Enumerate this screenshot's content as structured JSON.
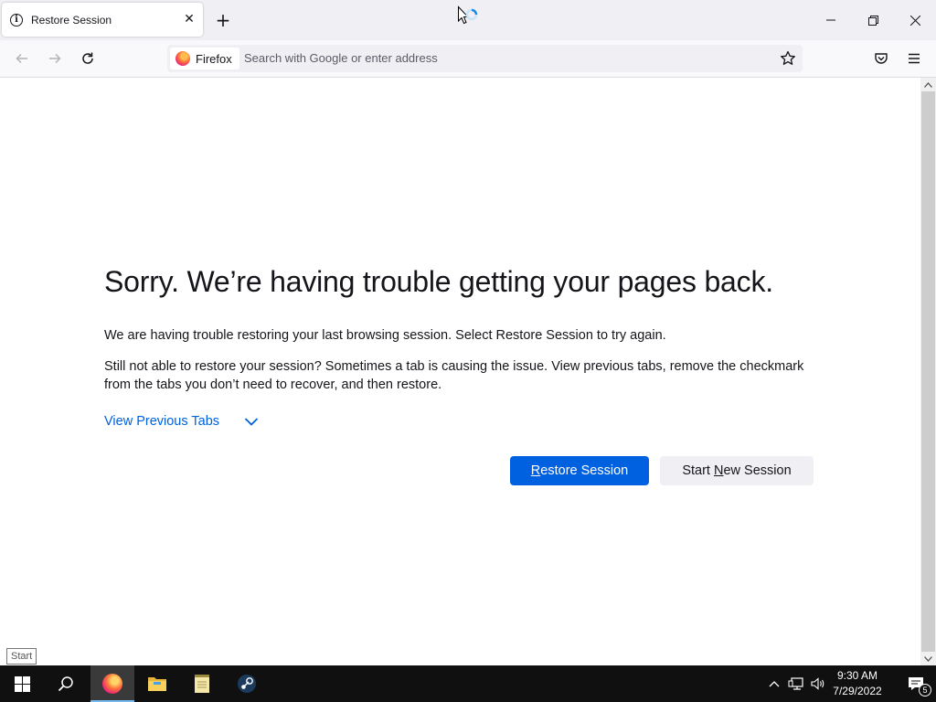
{
  "tab": {
    "title": "Restore Session"
  },
  "navbar": {
    "identity_label": "Firefox",
    "search_placeholder": "Search with Google or enter address"
  },
  "page": {
    "heading": "Sorry. We’re having trouble getting your pages back.",
    "paragraph1": "We are having trouble restoring your last browsing session. Select Restore Session to try again.",
    "paragraph2": "Still not able to restore your session? Sometimes a tab is causing the issue. View previous tabs, remove the checkmark from the tabs you don’t need to recover, and then restore.",
    "view_previous_tabs": "View Previous Tabs",
    "restore_button": {
      "pre": "",
      "accel": "R",
      "post": "estore Session"
    },
    "new_session_button": {
      "pre": "Start ",
      "accel": "N",
      "post": "ew Session"
    }
  },
  "start_tooltip": "Start",
  "taskbar": {
    "clock_time": "9:30 AM",
    "clock_date": "7/29/2022",
    "notification_count": "5"
  },
  "colors": {
    "accent": "#0061e0",
    "taskbar": "#101010",
    "chrome": "#f0f0f4"
  }
}
